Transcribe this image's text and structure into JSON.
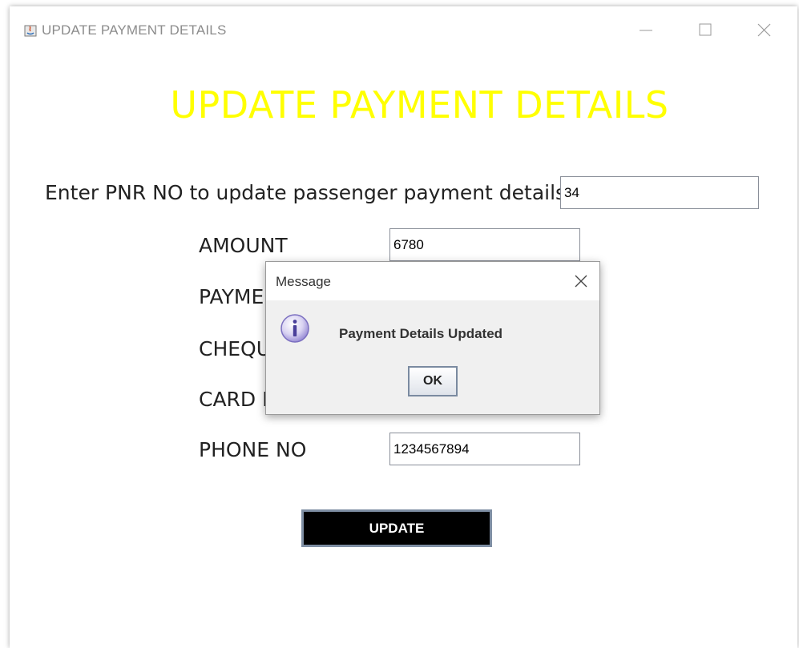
{
  "window": {
    "title": "UPDATE PAYMENT DETAILS",
    "controls": {
      "minimize": "minimize-icon",
      "maximize": "maximize-icon",
      "close": "close-icon"
    }
  },
  "form": {
    "heading": "UPDATE PAYMENT DETAILS",
    "heading_color": "#ffff00",
    "pnr_label": "Enter PNR NO to update passenger payment details",
    "pnr_value": "34",
    "fields": [
      {
        "label": "AMOUNT",
        "value": "6780"
      },
      {
        "label": "PAYME",
        "value": ""
      },
      {
        "label": "CHEQU",
        "value": ""
      },
      {
        "label": "CARD I",
        "value": ""
      },
      {
        "label": "PHONE NO",
        "value": "1234567894"
      }
    ],
    "update_label": "UPDATE"
  },
  "dialog": {
    "title": "Message",
    "icon": "info-icon",
    "message": "Payment Details Updated",
    "ok_label": "OK"
  }
}
